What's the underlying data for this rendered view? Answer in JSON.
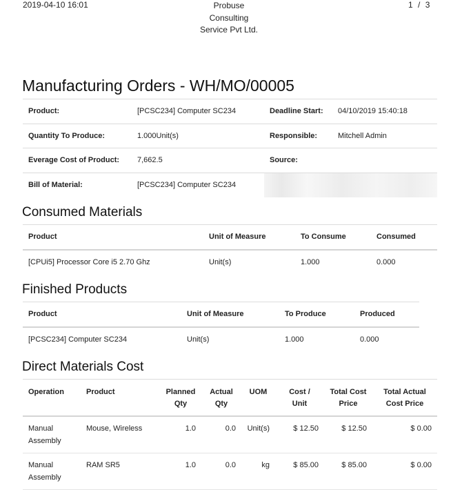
{
  "header": {
    "datetime": "2019-04-10 16:01",
    "company_line1": "Probuse",
    "company_line2": "Consulting",
    "company_line3": "Service Pvt Ltd.",
    "page_current": "1",
    "page_sep": "/",
    "page_total": "3"
  },
  "title": "Manufacturing Orders - WH/MO/00005",
  "info": {
    "product_label": "Product:",
    "product_value": "[PCSC234] Computer SC234",
    "deadline_label": "Deadline Start:",
    "deadline_value": "04/10/2019 15:40:18",
    "qty_label": "Quantity To Produce:",
    "qty_value": "1.000Unit(s)",
    "responsible_label": "Responsible:",
    "responsible_value": "Mitchell Admin",
    "cost_label": "Everage Cost of Product:",
    "cost_value": "7,662.5",
    "source_label": "Source:",
    "source_value": "",
    "bom_label": "Bill of Material:",
    "bom_value": "[PCSC234] Computer SC234"
  },
  "consumed": {
    "title": "Consumed Materials",
    "headers": [
      "Product",
      "Unit of Measure",
      "To Consume",
      "Consumed"
    ],
    "rows": [
      [
        "[CPUi5] Processor Core i5 2.70 Ghz",
        "Unit(s)",
        "1.000",
        "0.000"
      ]
    ]
  },
  "finished": {
    "title": "Finished Products",
    "headers": [
      "Product",
      "Unit of Measure",
      "To Produce",
      "Produced"
    ],
    "rows": [
      [
        "[PCSC234] Computer SC234",
        "Unit(s)",
        "1.000",
        "0.000"
      ]
    ]
  },
  "direct_cost": {
    "title": "Direct Materials Cost",
    "headers": {
      "operation": "Operation",
      "product": "Product",
      "planned_1": "Planned",
      "planned_2": "Qty",
      "actual_1": "Actual",
      "actual_2": "Qty",
      "uom": "UOM",
      "cost_1": "Cost /",
      "cost_2": "Unit",
      "total_1": "Total Cost",
      "total_2": "Price",
      "actual_total_1": "Total Actual",
      "actual_total_2": "Cost Price"
    },
    "rows": [
      {
        "op1": "Manual",
        "op2": "Assembly",
        "product": "Mouse, Wireless",
        "planned": "1.0",
        "actual": "0.0",
        "uom": "Unit(s)",
        "cost": "$ 12.50",
        "total": "$ 12.50",
        "actual_total": "$ 0.00"
      },
      {
        "op1": "Manual",
        "op2": "Assembly",
        "product": "RAM SR5",
        "planned": "1.0",
        "actual": "0.0",
        "uom": "kg",
        "cost": "$ 85.00",
        "total": "$ 85.00",
        "actual_total": "$ 0.00"
      }
    ]
  }
}
